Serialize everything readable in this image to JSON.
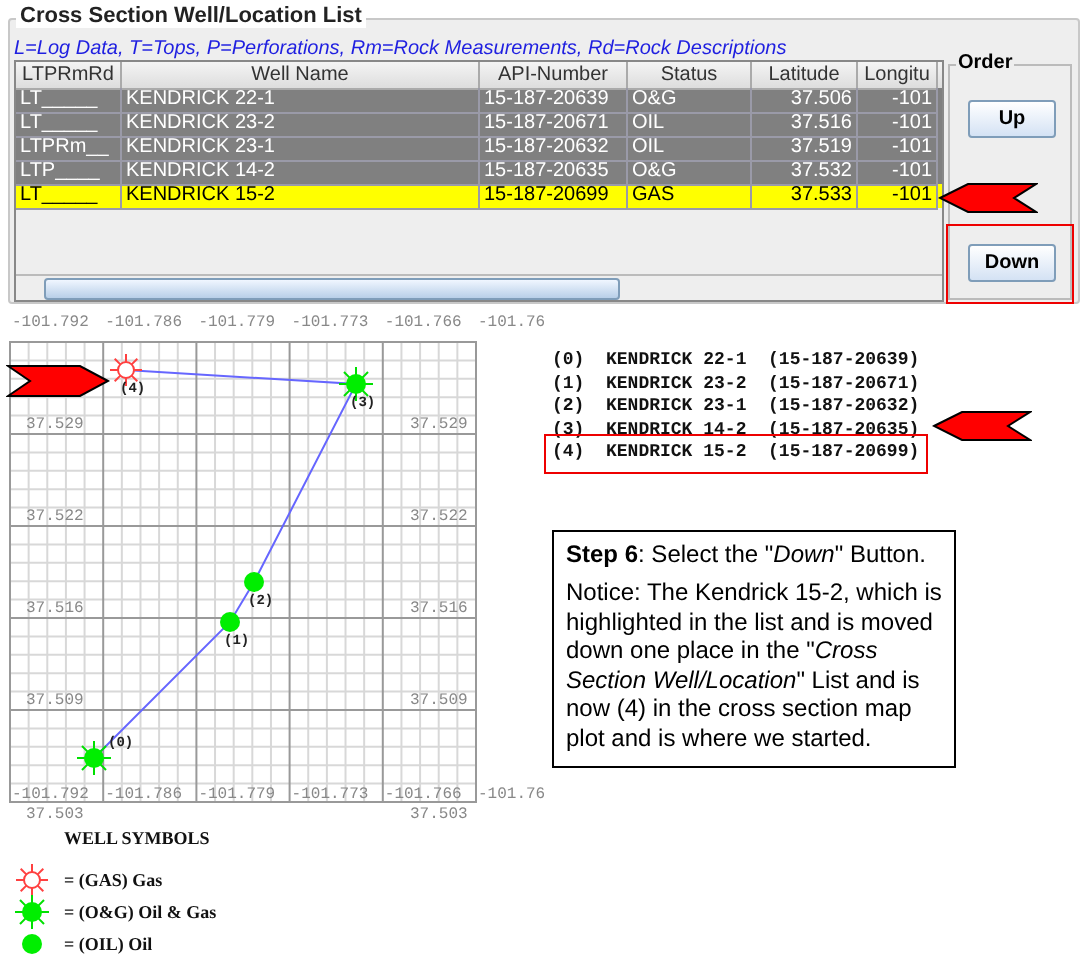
{
  "panel": {
    "title": "Cross Section Well/Location List",
    "legend": "L=Log Data, T=Tops, P=Perforations, Rm=Rock Measurements, Rd=Rock Descriptions",
    "table": {
      "columns": [
        "LTPRmRd",
        "Well Name",
        "API-Number",
        "Status",
        "Latitude",
        "Longitu"
      ],
      "rows": [
        {
          "cells": [
            "LT_____",
            "KENDRICK 22-1",
            "15-187-20639",
            "O&G",
            "37.506",
            "-101"
          ],
          "selected": false
        },
        {
          "cells": [
            "LT_____",
            "KENDRICK 23-2",
            "15-187-20671",
            "OIL",
            "37.516",
            "-101"
          ],
          "selected": false
        },
        {
          "cells": [
            "LTPRm__",
            "KENDRICK 23-1",
            "15-187-20632",
            "OIL",
            "37.519",
            "-101"
          ],
          "selected": false
        },
        {
          "cells": [
            "LTP____",
            "KENDRICK 14-2",
            "15-187-20635",
            "O&G",
            "37.532",
            "-101"
          ],
          "selected": false
        },
        {
          "cells": [
            "LT_____",
            "KENDRICK 15-2",
            "15-187-20699",
            "GAS",
            "37.533",
            "-101"
          ],
          "selected": true
        }
      ]
    },
    "order": {
      "title": "Order",
      "buttons": [
        {
          "label": "Up",
          "highlighted": false
        },
        {
          "label": "Down",
          "highlighted": true
        }
      ]
    }
  },
  "map": {
    "top_labels": [
      "-101.792",
      "-101.786",
      "-101.779",
      "-101.773",
      "-101.766",
      "-101.76"
    ],
    "bottom_labels": [
      "-101.792",
      "-101.786",
      "-101.779",
      "-101.773",
      "-101.766",
      "-101.76"
    ],
    "left_labels": [
      "37.529",
      "37.522",
      "37.516",
      "37.509",
      "37.503"
    ],
    "right_labels": [
      "37.529",
      "37.522",
      "37.516",
      "37.509",
      "37.503"
    ],
    "wells": [
      {
        "label": "(0)",
        "kind": "oil_gas"
      },
      {
        "label": "(1)",
        "kind": "oil"
      },
      {
        "label": "(2)",
        "kind": "oil"
      },
      {
        "label": "(3)",
        "kind": "oil_gas"
      },
      {
        "label": "(4)",
        "kind": "gas"
      }
    ]
  },
  "symbols": {
    "title": "WELL SYMBOLS",
    "items": [
      {
        "kind": "gas",
        "text": "= (GAS) Gas"
      },
      {
        "kind": "oil_gas",
        "text": "= (O&G) Oil & Gas"
      },
      {
        "kind": "oil",
        "text": "= (OIL) Oil"
      }
    ]
  },
  "listing": [
    {
      "text": "(0)  KENDRICK 22-1  (15-187-20639)",
      "highlighted": false
    },
    {
      "text": "(1)  KENDRICK 23-2  (15-187-20671)",
      "highlighted": false
    },
    {
      "text": "(2)  KENDRICK 23-1  (15-187-20632)",
      "highlighted": false
    },
    {
      "text": "(3)  KENDRICK 14-2  (15-187-20635)",
      "highlighted": false
    },
    {
      "text": "(4)  KENDRICK 15-2  (15-187-20699)",
      "highlighted": true
    }
  ],
  "note": {
    "heading": "**Step 6**: Select the \"*Down*\" Button.",
    "body": "Notice: The Kendrick 15-2, which is highlighted in the list and is moved down one place in the \"*Cross Section Well/Location*\" List and is now (4) in the cross section map plot and is where we started."
  }
}
